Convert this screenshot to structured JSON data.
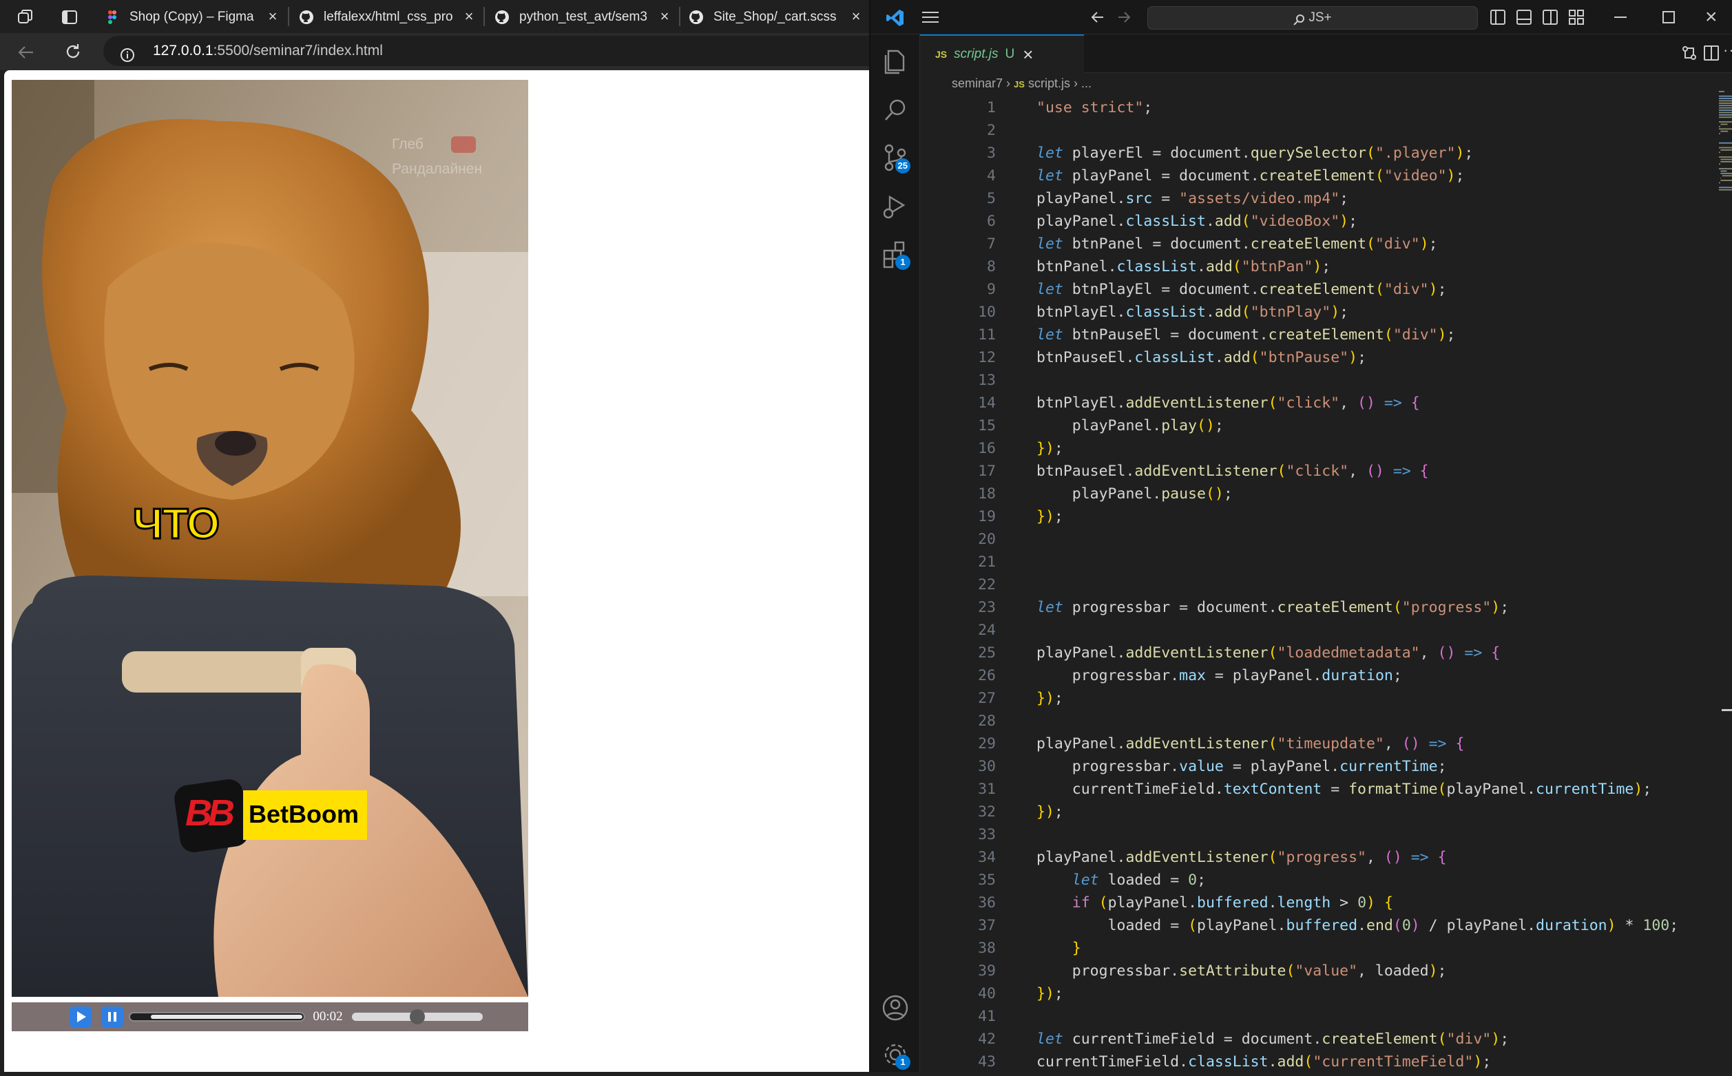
{
  "browser": {
    "tabs": [
      {
        "title": "Shop (Copy) – Figma",
        "icon": "figma-icon"
      },
      {
        "title": "leffalexx/html_css_pro",
        "icon": "github-icon"
      },
      {
        "title": "python_test_avt/sem3",
        "icon": "github-icon"
      },
      {
        "title": "Site_Shop/_cart.scss",
        "icon": "github-icon"
      }
    ],
    "url_host": "127.0.0.1",
    "url_rest": ":5500/seminar7/index.html"
  },
  "page": {
    "video_caption": "ЧТО",
    "watermark_line1": "Глеб",
    "watermark_line2": "Рандалайнен",
    "ad_brand": "BetBoom",
    "ad_mark": "BB",
    "current_time": "00:02",
    "progress_fraction": 0.0,
    "seek_fraction": 0.5
  },
  "vscode": {
    "search_placeholder": "JS+",
    "file_tab": "script.js",
    "file_tab_status": "U",
    "file_tab_lang": "JS",
    "breadcrumb": {
      "folder": "seminar7",
      "file": "script.js",
      "more": "..."
    },
    "badges": {
      "source_control": "25",
      "extensions": "1",
      "settings": "1"
    },
    "lines": [
      "\"use strict\";",
      "",
      "let playerEl = document.querySelector(\".player\");",
      "let playPanel = document.createElement(\"video\");",
      "playPanel.src = \"assets/video.mp4\";",
      "playPanel.classList.add(\"videoBox\");",
      "let btnPanel = document.createElement(\"div\");",
      "btnPanel.classList.add(\"btnPan\");",
      "let btnPlayEl = document.createElement(\"div\");",
      "btnPlayEl.classList.add(\"btnPlay\");",
      "let btnPauseEl = document.createElement(\"div\");",
      "btnPauseEl.classList.add(\"btnPause\");",
      "",
      "btnPlayEl.addEventListener(\"click\", () => {",
      "    playPanel.play();",
      "});",
      "btnPauseEl.addEventListener(\"click\", () => {",
      "    playPanel.pause();",
      "});",
      "",
      "",
      "",
      "let progressbar = document.createElement(\"progress\");",
      "",
      "playPanel.addEventListener(\"loadedmetadata\", () => {",
      "    progressbar.max = playPanel.duration;",
      "});",
      "",
      "playPanel.addEventListener(\"timeupdate\", () => {",
      "    progressbar.value = playPanel.currentTime;",
      "    currentTimeField.textContent = formatTime(playPanel.currentTime);",
      "});",
      "",
      "playPanel.addEventListener(\"progress\", () => {",
      "    let loaded = 0;",
      "    if (playPanel.buffered.length > 0) {",
      "        loaded = (playPanel.buffered.end(0) / playPanel.duration) * 100;",
      "    }",
      "    progressbar.setAttribute(\"value\", loaded);",
      "});",
      "",
      "let currentTimeField = document.createElement(\"div\");",
      "currentTimeField.classList.add(\"currentTimeField\");"
    ]
  }
}
